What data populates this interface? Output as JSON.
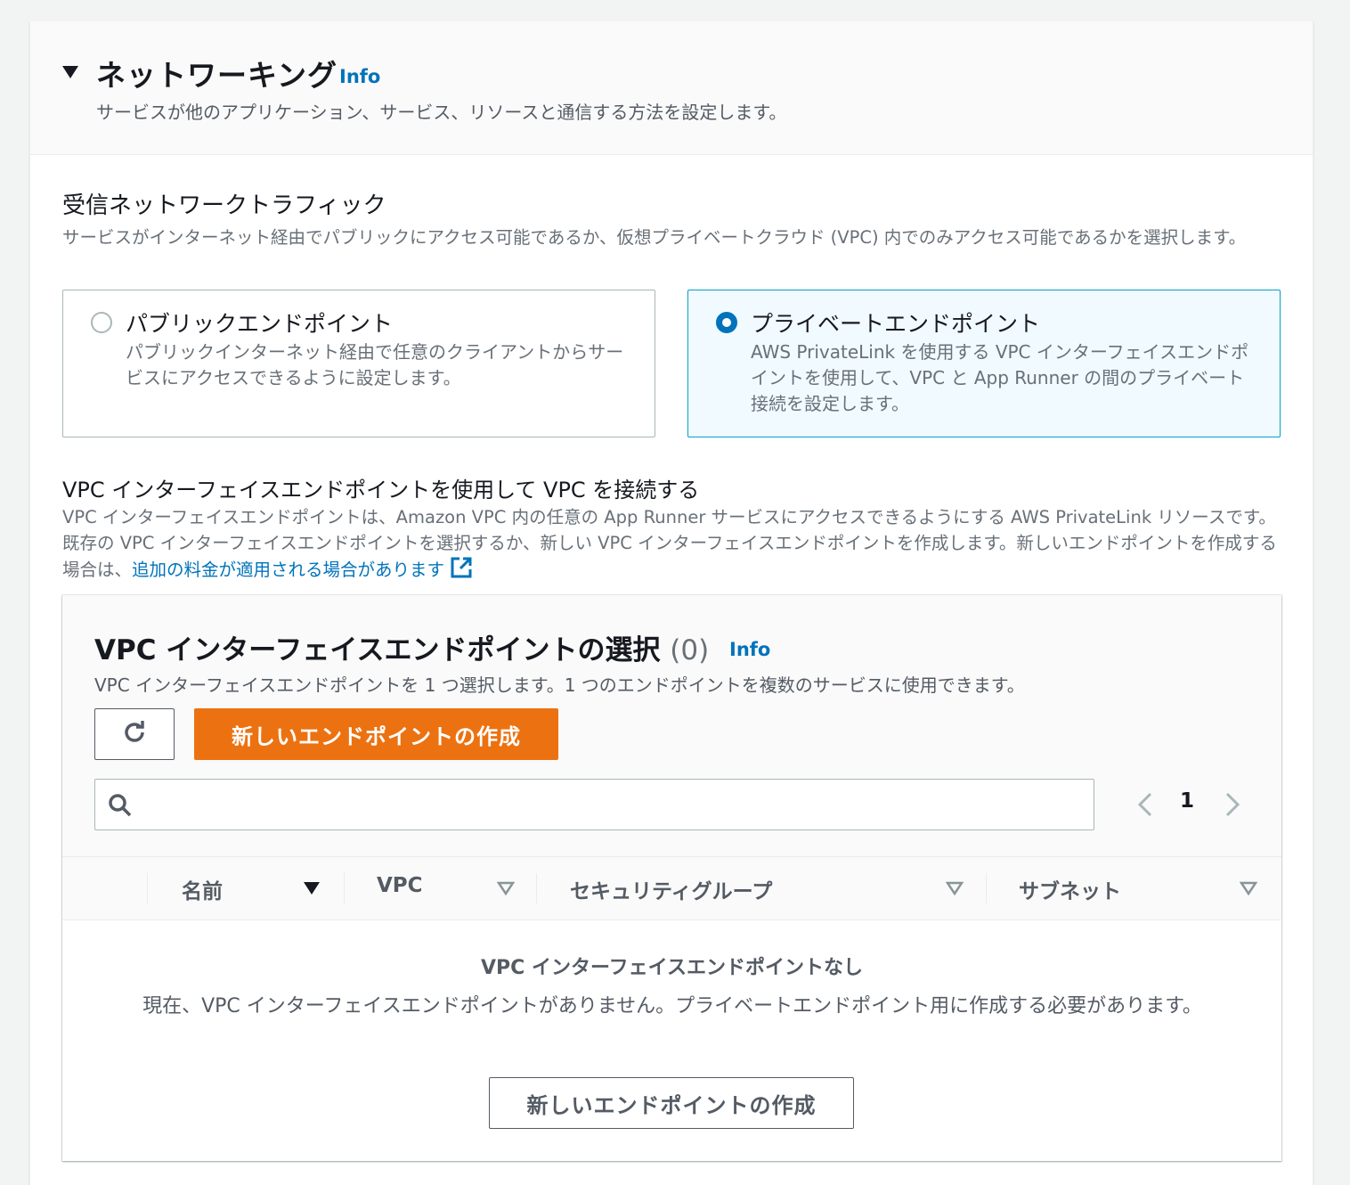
{
  "networking": {
    "title": "ネットワーキング",
    "info": "Info",
    "description": "サービスが他のアプリケーション、サービス、リソースと通信する方法を設定します。"
  },
  "incoming": {
    "title": "受信ネットワークトラフィック",
    "description": "サービスがインターネット経由でパブリックにアクセス可能であるか、仮想プライベートクラウド (VPC) 内でのみアクセス可能であるかを選択します。",
    "options": [
      {
        "label": "パブリックエンドポイント",
        "description": "パブリックインターネット経由で任意のクライアントからサービスにアクセスできるように設定します。",
        "selected": false
      },
      {
        "label": "プライベートエンドポイント",
        "description": "AWS PrivateLink を使用する VPC インターフェイスエンドポイントを使用して、VPC と App Runner の間のプライベート接続を設定します。",
        "selected": true
      }
    ]
  },
  "vpc_connect": {
    "title": "VPC インターフェイスエンドポイントを使用して VPC を接続する",
    "description": "VPC インターフェイスエンドポイントは、Amazon VPC 内の任意の App Runner サービスにアクセスできるようにする AWS PrivateLink リソースです。既存の VPC インターフェイスエンドポイントを選択するか、新しい VPC インターフェイスエンドポイントを作成します。新しいエンドポイントを作成する場合は、",
    "link": "追加の料金が適用される場合があります"
  },
  "endpoint_table": {
    "title": "VPC インターフェイスエンドポイントの選択",
    "count": "(0)",
    "info": "Info",
    "description": "VPC インターフェイスエンドポイントを 1 つ選択します。1 つのエンドポイントを複数のサービスに使用できます。",
    "refresh_icon": "refresh-icon",
    "create_button": "新しいエンドポイントの作成",
    "search_placeholder": "",
    "page": "1",
    "columns": [
      "名前",
      "VPC",
      "セキュリティグループ",
      "サブネット"
    ],
    "empty_title": "VPC インターフェイスエンドポイントなし",
    "empty_description": "現在、VPC インターフェイスエンドポイントがありません。プライベートエンドポイント用に作成する必要があります。",
    "empty_button": "新しいエンドポイントの作成"
  },
  "colors": {
    "accent": "#0073bb",
    "primary_button": "#ec7211",
    "selected_tile_bg": "#f1faff",
    "selected_tile_border": "#00a1c9"
  }
}
